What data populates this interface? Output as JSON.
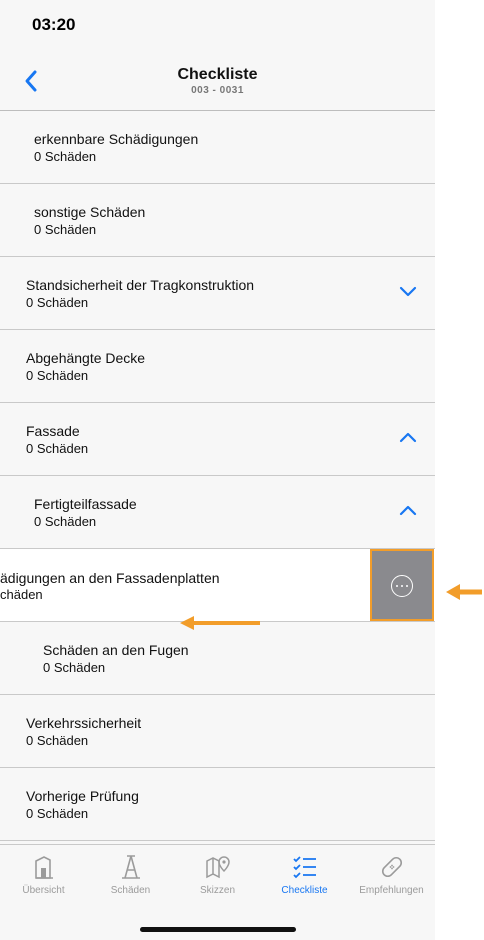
{
  "status_bar": {
    "time": "03:20"
  },
  "nav": {
    "title": "Checkliste",
    "subtitle": "003 - 0031",
    "back_icon": "chevron-left-icon"
  },
  "list": [
    {
      "title": "erkennbare Schädigungen",
      "count": "0 Schäden",
      "indent": 2,
      "chevron": "none"
    },
    {
      "title": "sonstige Schäden",
      "count": "0 Schäden",
      "indent": 2,
      "chevron": "none"
    },
    {
      "title": "Standsicherheit der Tragkonstruktion",
      "count": "0 Schäden",
      "indent": 1,
      "chevron": "down"
    },
    {
      "title": "Abgehängte Decke",
      "count": "0 Schäden",
      "indent": 1,
      "chevron": "none"
    },
    {
      "title": "Fassade",
      "count": "0 Schäden",
      "indent": 1,
      "chevron": "up"
    },
    {
      "title": "Fertigteilfassade",
      "count": "0 Schäden",
      "indent": 2,
      "chevron": "up"
    }
  ],
  "swiped_row": {
    "title": "ädigungen an den Fassadenplatten",
    "count": "chäden",
    "action_icon": "more-options-icon"
  },
  "list_after": [
    {
      "title": "Schäden an den Fugen",
      "count": "0 Schäden",
      "indent": 3
    },
    {
      "title": "Verkehrssicherheit",
      "count": "0 Schäden",
      "indent": 1
    },
    {
      "title": "Vorherige Prüfung",
      "count": "0 Schäden",
      "indent": 1
    }
  ],
  "tabs": [
    {
      "label": "Übersicht",
      "icon": "building-icon",
      "active": false
    },
    {
      "label": "Schäden",
      "icon": "crack-icon",
      "active": false
    },
    {
      "label": "Skizzen",
      "icon": "map-pin-icon",
      "active": false
    },
    {
      "label": "Checkliste",
      "icon": "checklist-icon",
      "active": true
    },
    {
      "label": "Empfehlungen",
      "icon": "bandage-icon",
      "active": false
    }
  ],
  "colors": {
    "accent": "#1877f2",
    "annotation": "#f29d2a",
    "action_bg": "#8a8a8e"
  }
}
